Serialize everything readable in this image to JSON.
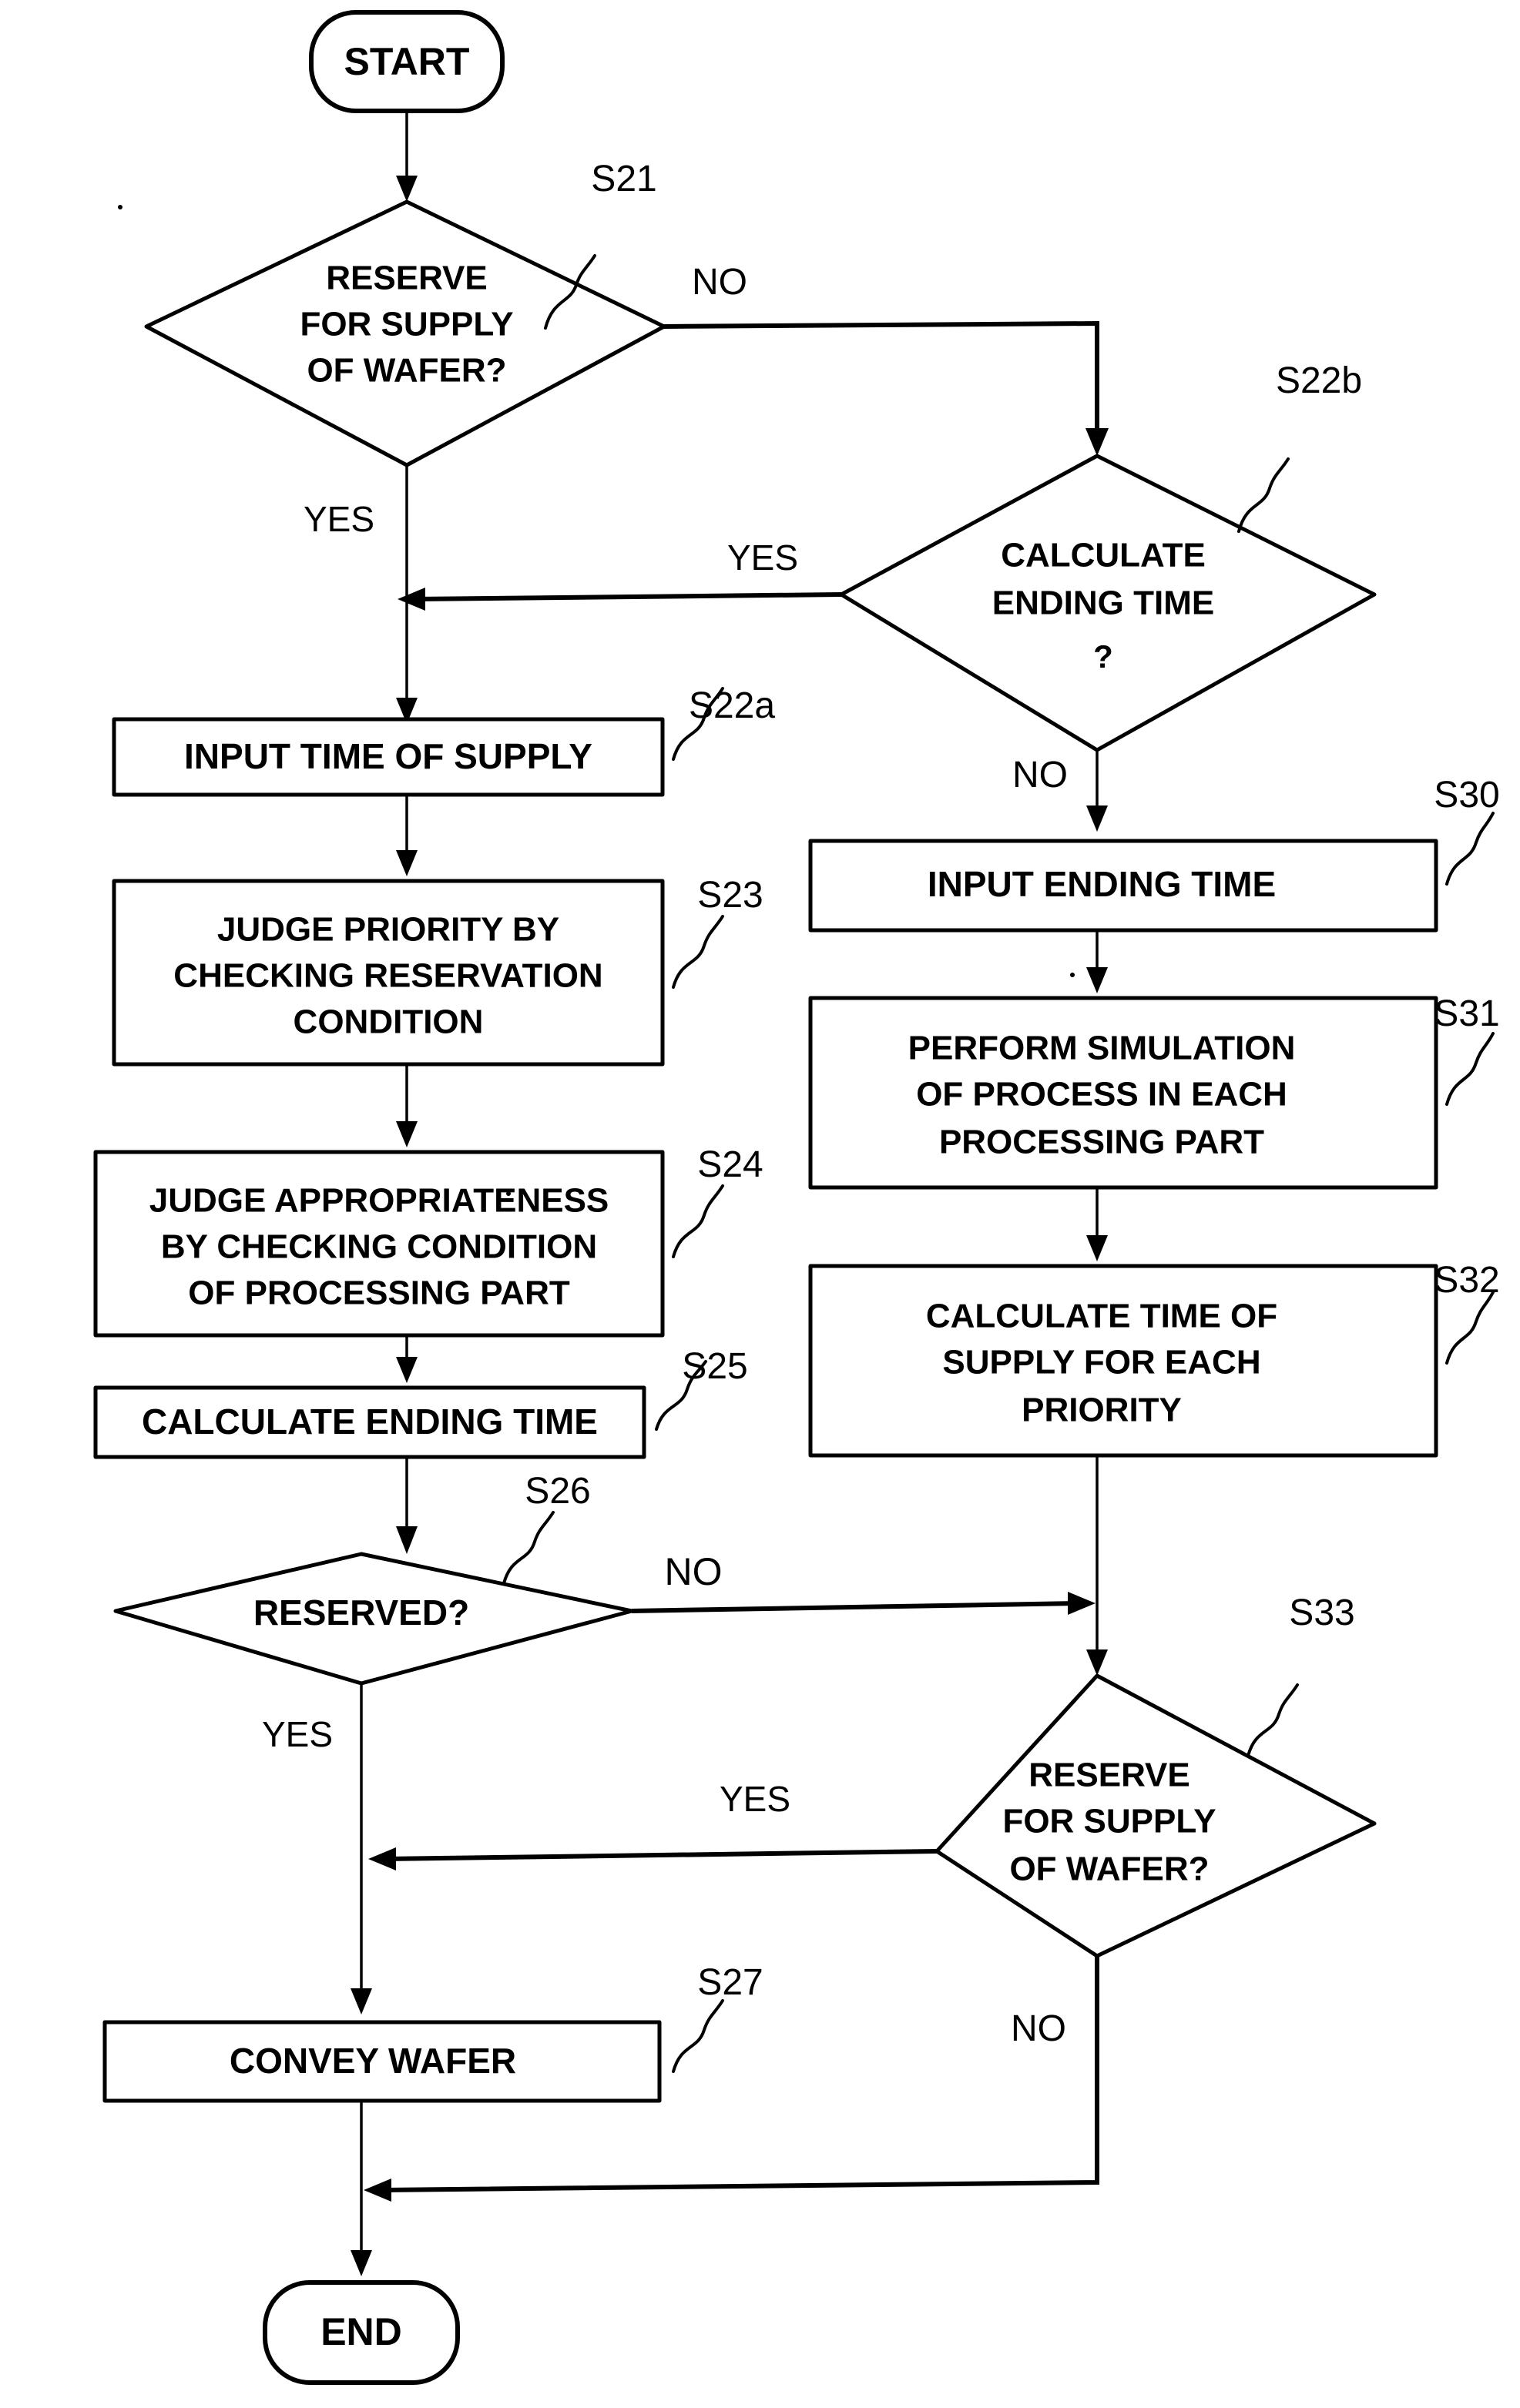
{
  "diagram": {
    "type": "flowchart",
    "title": "",
    "orientation": "top-to-bottom, two columns"
  },
  "nodes": {
    "start": {
      "label": "START",
      "shape": "terminal",
      "step": ""
    },
    "s21": {
      "label_line1": "RESERVE",
      "label_line2": "FOR SUPPLY",
      "label_line3": "OF WAFER?",
      "shape": "decision",
      "step": "S21"
    },
    "s22b": {
      "label_line1": "CALCULATE",
      "label_line2": "ENDING TIME",
      "label_line3": "?",
      "shape": "decision",
      "step": "S22b"
    },
    "s22a": {
      "label_line1": "INPUT TIME OF SUPPLY",
      "shape": "process",
      "step": "S22a"
    },
    "s23": {
      "label_line1": "JUDGE PRIORITY BY",
      "label_line2": "CHECKING RESERVATION",
      "label_line3": "CONDITION",
      "shape": "process",
      "step": "S23"
    },
    "s24": {
      "label_line1": "JUDGE APPROPRIATENESS",
      "label_line2": "BY CHECKING CONDITION",
      "label_line3": "OF PROCESSING PART",
      "shape": "process",
      "step": "S24"
    },
    "s25": {
      "label_line1": "CALCULATE ENDING TIME",
      "shape": "process",
      "step": "S25"
    },
    "s26": {
      "label_line1": "RESERVED?",
      "shape": "decision",
      "step": "S26"
    },
    "s27": {
      "label_line1": "CONVEY WAFER",
      "shape": "process",
      "step": "S27"
    },
    "s30": {
      "label_line1": "INPUT ENDING TIME",
      "shape": "process",
      "step": "S30"
    },
    "s31": {
      "label_line1": "PERFORM SIMULATION",
      "label_line2": "OF PROCESS IN EACH",
      "label_line3": "PROCESSING PART",
      "shape": "process",
      "step": "S31"
    },
    "s32": {
      "label_line1": "CALCULATE TIME OF",
      "label_line2": "SUPPLY FOR EACH",
      "label_line3": "PRIORITY",
      "shape": "process",
      "step": "S32"
    },
    "s33": {
      "label_line1": "RESERVE",
      "label_line2": "FOR SUPPLY",
      "label_line3": "OF WAFER?",
      "shape": "decision",
      "step": "S33"
    },
    "end": {
      "label": "END",
      "shape": "terminal",
      "step": ""
    }
  },
  "edge_labels": {
    "s21_no": "NO",
    "s21_yes": "YES",
    "s22b_yes": "YES",
    "s22b_no": "NO",
    "s26_no": "NO",
    "s26_yes": "YES",
    "s33_yes": "YES",
    "s33_no": "NO"
  },
  "colors": {
    "line": "#000000",
    "background": "#ffffff",
    "text": "#000000"
  }
}
